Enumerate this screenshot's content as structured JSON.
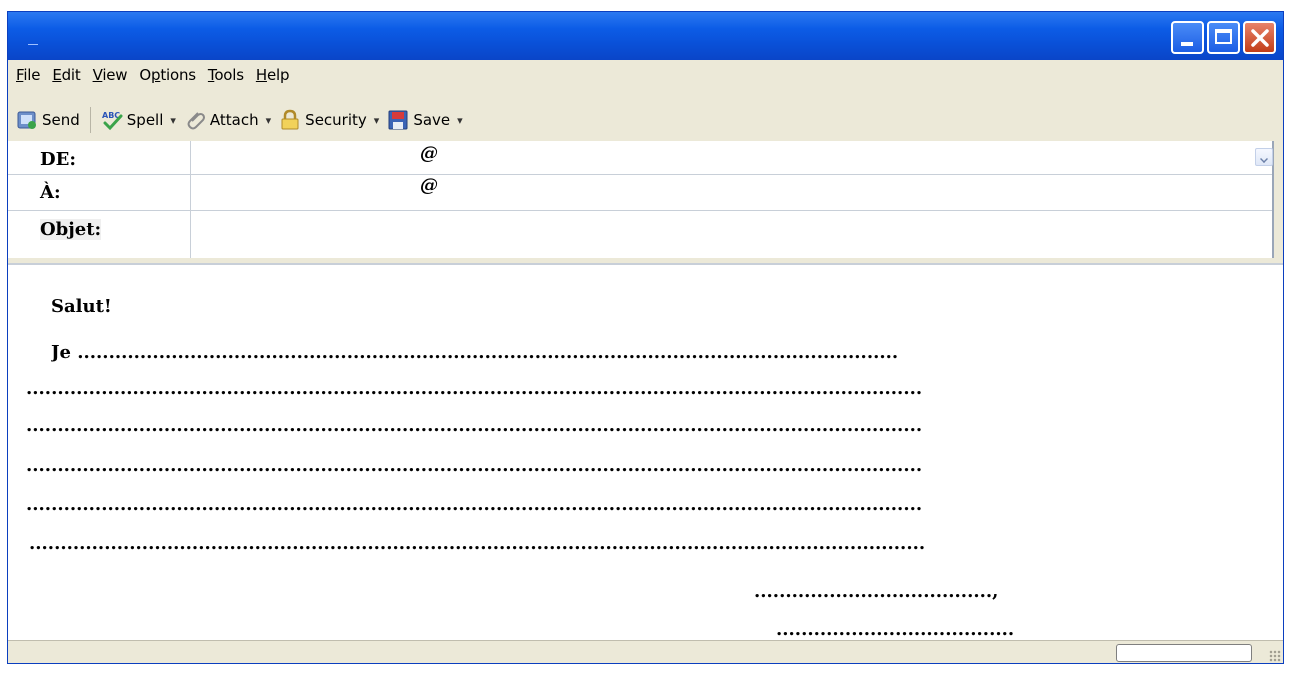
{
  "window": {
    "title": ""
  },
  "menu": {
    "items": [
      "File",
      "Edit",
      "View",
      "Options",
      "Tools",
      "Help"
    ],
    "underline": [
      "F",
      "E",
      "V",
      "p",
      "T",
      "H"
    ]
  },
  "toolbar": {
    "send": "Send",
    "spell": "Spell",
    "attach": "Attach",
    "security": "Security",
    "save": "Save",
    "dropdown_arrow": "▾"
  },
  "fields": {
    "from": {
      "label": "DE:",
      "value": "@"
    },
    "to": {
      "label": "À:",
      "value": "@"
    },
    "subject": {
      "label": "Objet:",
      "value": ""
    }
  },
  "message": {
    "greeting": "Salut!",
    "first_line": "Je ...................................................................................................................................",
    "blank_line": "...............................................................................................................................................",
    "closing": "......................................,",
    "signature": "......................................"
  },
  "colors": {
    "titlebar": "#0a4fd6",
    "chrome": "#ece9d8",
    "close": "#c23d18"
  }
}
